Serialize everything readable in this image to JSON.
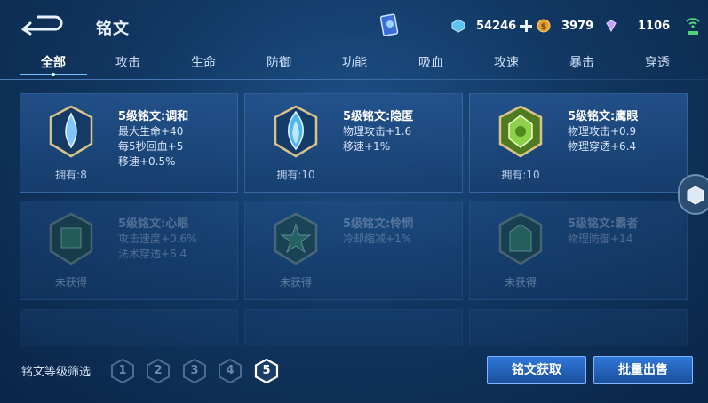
{
  "header": {
    "title": "铭文",
    "resources": {
      "coupon": "54246",
      "gold": "3979",
      "gem": "1106"
    }
  },
  "tabs": [
    {
      "label": "全部",
      "active": true
    },
    {
      "label": "攻击"
    },
    {
      "label": "生命"
    },
    {
      "label": "防御"
    },
    {
      "label": "功能"
    },
    {
      "label": "吸血"
    },
    {
      "label": "攻速"
    },
    {
      "label": "暴击"
    },
    {
      "label": "穿透"
    }
  ],
  "runes": [
    {
      "name": "5级铭文:调和",
      "stats": [
        "最大生命+40",
        "每5秒回血+5",
        "移速+0.5%"
      ],
      "owned": "拥有:8",
      "locked": false,
      "color": "#4a8fd0"
    },
    {
      "name": "5级铭文:隐匿",
      "stats": [
        "物理攻击+1.6",
        "移速+1%"
      ],
      "owned": "拥有:10",
      "locked": false,
      "color": "#3ea0e0"
    },
    {
      "name": "5级铭文:鹰眼",
      "stats": [
        "物理攻击+0.9",
        "物理穿透+6.4"
      ],
      "owned": "拥有:10",
      "locked": false,
      "color": "#6fb23a"
    },
    {
      "name": "5级铭文:心眼",
      "stats": [
        "攻击速度+0.6%",
        "法术穿透+6.4"
      ],
      "owned": "未获得",
      "locked": true,
      "color": "#3c8f5a"
    },
    {
      "name": "5级铭文:怜悯",
      "stats": [
        "冷却缩减+1%"
      ],
      "owned": "未获得",
      "locked": true,
      "color": "#3c8f5a"
    },
    {
      "name": "5级铭文:霸者",
      "stats": [
        "物理防御+14"
      ],
      "owned": "未获得",
      "locked": true,
      "color": "#3c8f5a"
    }
  ],
  "footer": {
    "filter_label": "铭文等级筛选",
    "levels": [
      "1",
      "2",
      "3",
      "4",
      "5"
    ],
    "active_level": "5",
    "acquire_button": "铭文获取",
    "sell_button": "批量出售"
  }
}
